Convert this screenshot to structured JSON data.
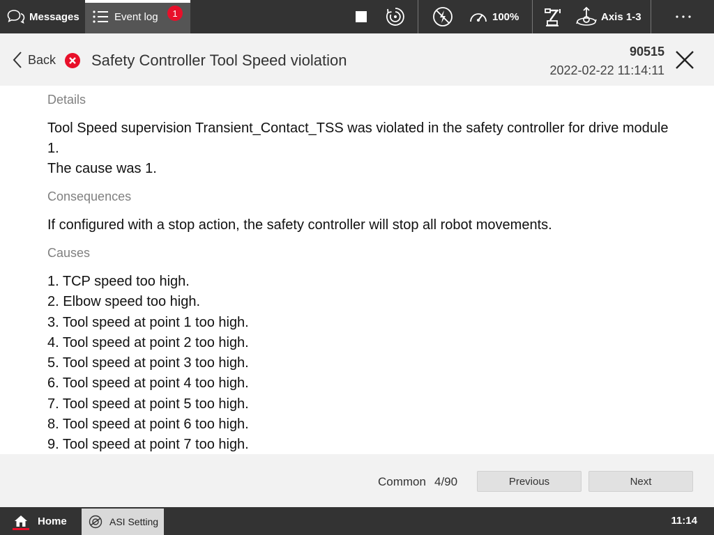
{
  "topbar": {
    "messages_label": "Messages",
    "messages_icon": "chat-bubbles-icon",
    "eventlog_label": "Event log",
    "eventlog_icon": "list-icon",
    "eventlog_badge": "1",
    "stop_icon": "stop-icon",
    "run_mode_icon": "run-mode-icon",
    "motors_icon": "motors-off-icon",
    "speed_icon": "speedometer-icon",
    "speed_value": "100%",
    "robot_icon": "robot-icon",
    "jog_icon": "jog-icon",
    "axis_label": "Axis 1-3",
    "more_icon": "more-dots-icon"
  },
  "header": {
    "back_label": "Back",
    "status_icon": "error-icon",
    "status_color": "#e8102a",
    "title": "Safety Controller Tool Speed violation",
    "event_number": "90515",
    "event_timestamp": "2022-02-22 11:14:11"
  },
  "details": {
    "heading": "Details",
    "line1": "Tool Speed supervision Transient_Contact_TSS was violated in the safety controller for drive module 1.",
    "line2": "The cause was 1."
  },
  "consequences": {
    "heading": "Consequences",
    "text": "If configured with a stop action, the safety controller will stop all robot movements."
  },
  "causes": {
    "heading": "Causes",
    "items": [
      "1. TCP speed too high.",
      "2. Elbow speed too high.",
      "3. Tool speed at point 1 too high.",
      "4. Tool speed at point 2 too high.",
      "5. Tool speed at point 3 too high.",
      "6. Tool speed at point 4 too high.",
      "7. Tool speed at point 5 too high.",
      "8. Tool speed at point 6 too high.",
      "9. Tool speed at point 7 too high."
    ]
  },
  "footer": {
    "category": "Common",
    "position": "4/90",
    "previous_label": "Previous",
    "next_label": "Next"
  },
  "taskbar": {
    "home_label": "Home",
    "home_icon": "home-icon",
    "accent_color": "#e8102a",
    "app_label": "ASI Setting",
    "app_icon": "asi-settings-icon",
    "clock": "11:14"
  }
}
